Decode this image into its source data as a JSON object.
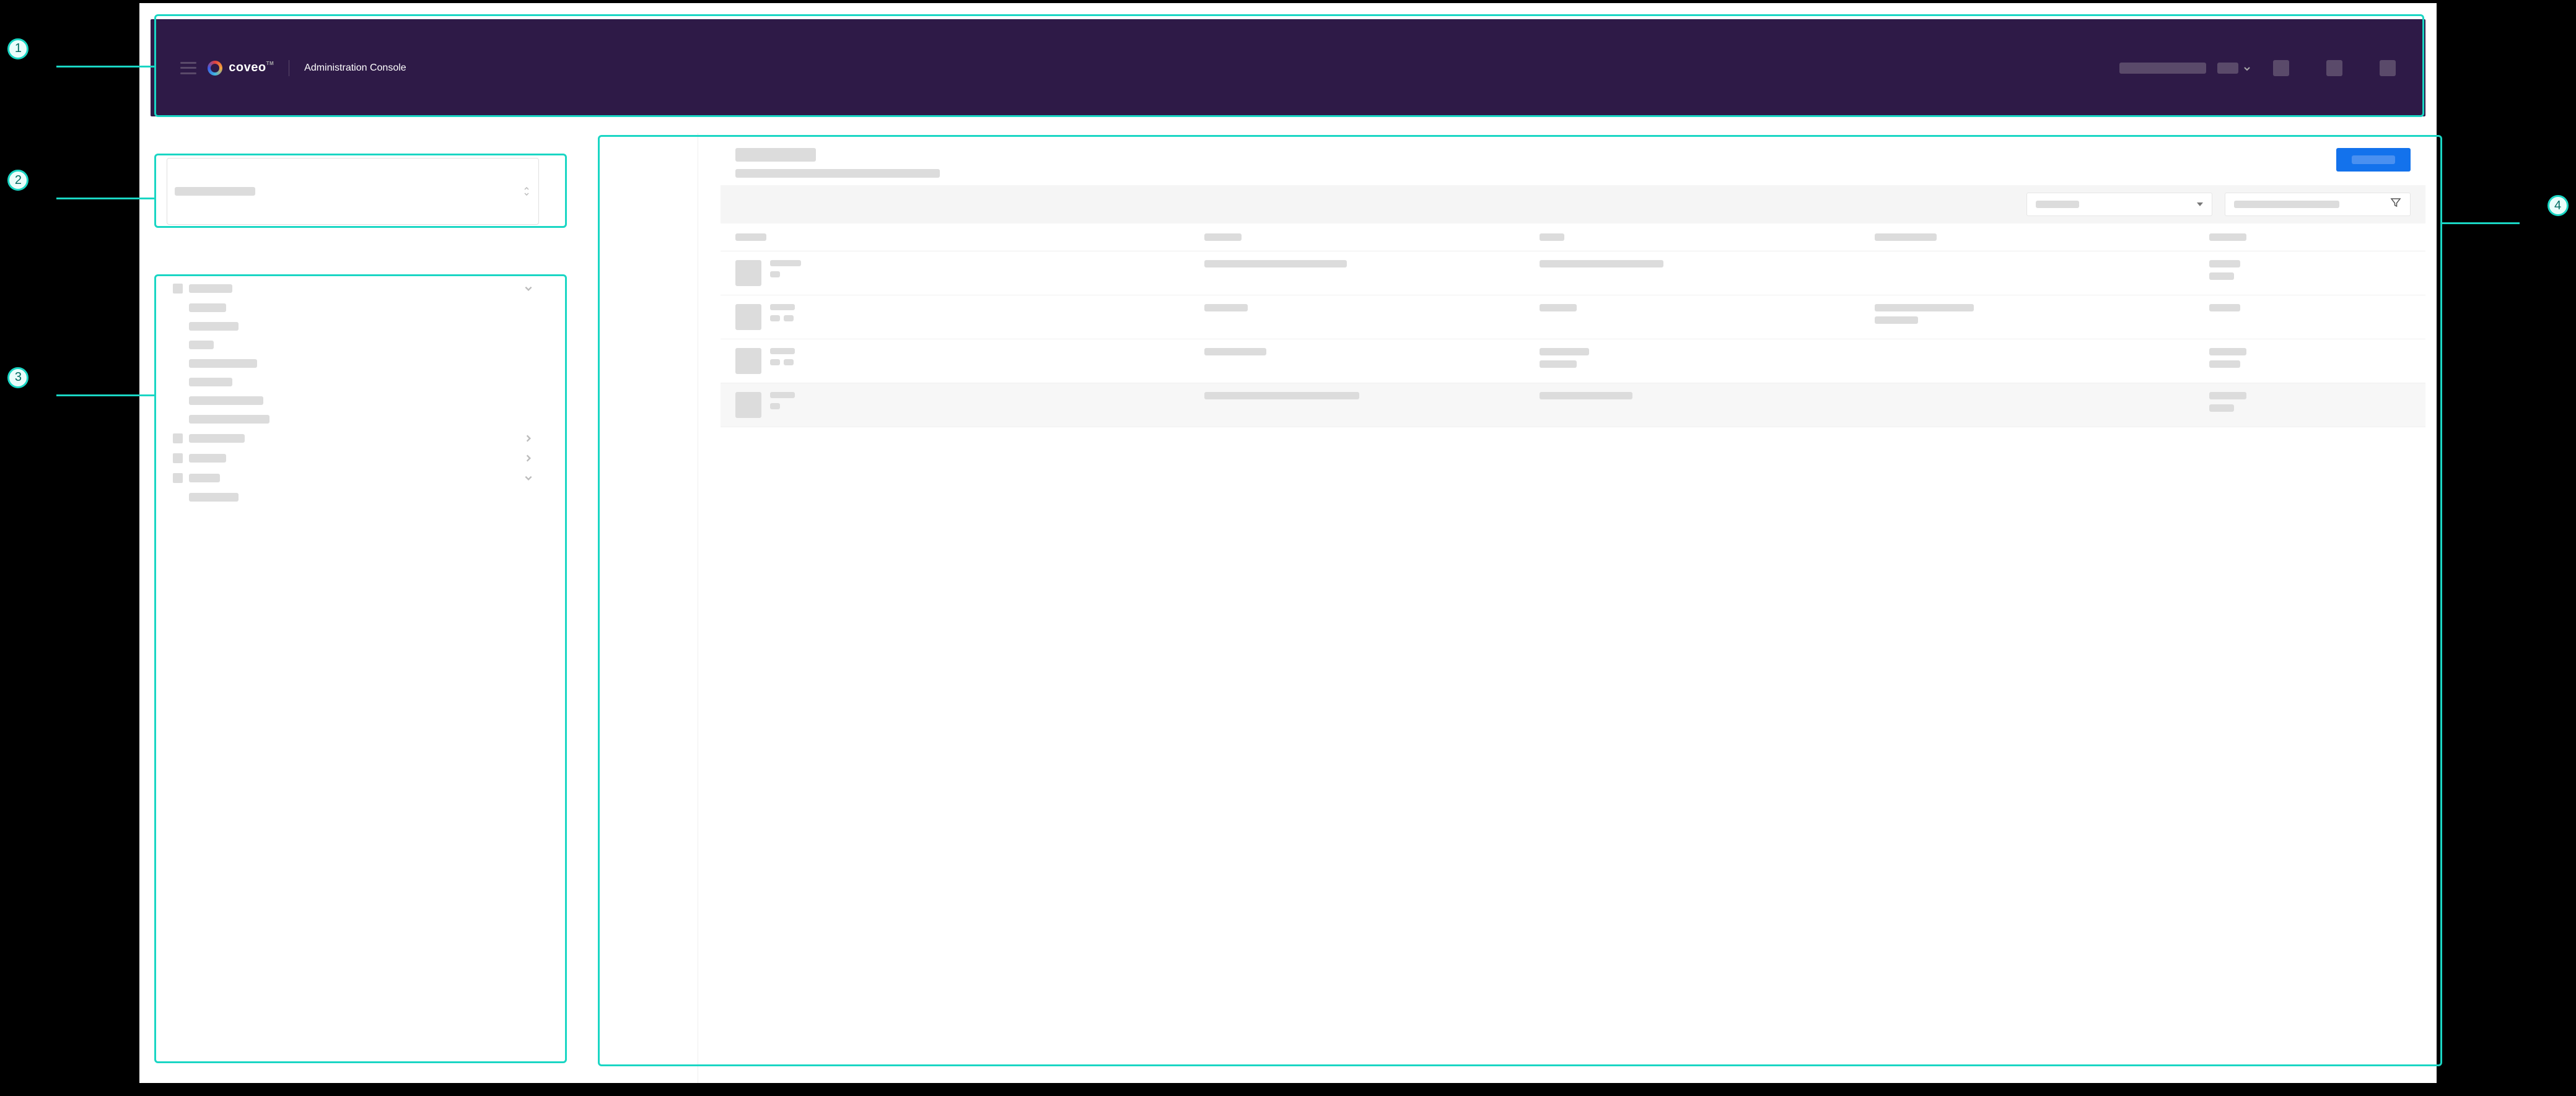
{
  "annotations": {
    "callouts": [
      {
        "n": "1",
        "target": "header"
      },
      {
        "n": "2",
        "target": "organization-picker"
      },
      {
        "n": "3",
        "target": "navigation-sidebar"
      },
      {
        "n": "4",
        "target": "main-content-panel"
      }
    ]
  },
  "header": {
    "brand": "coveo",
    "tm": "TM",
    "subtitle": "Administration Console"
  },
  "colors": {
    "header_bg": "#2e1a47",
    "primary_btn": "#1372ec",
    "callout": "#1ad6c4"
  }
}
